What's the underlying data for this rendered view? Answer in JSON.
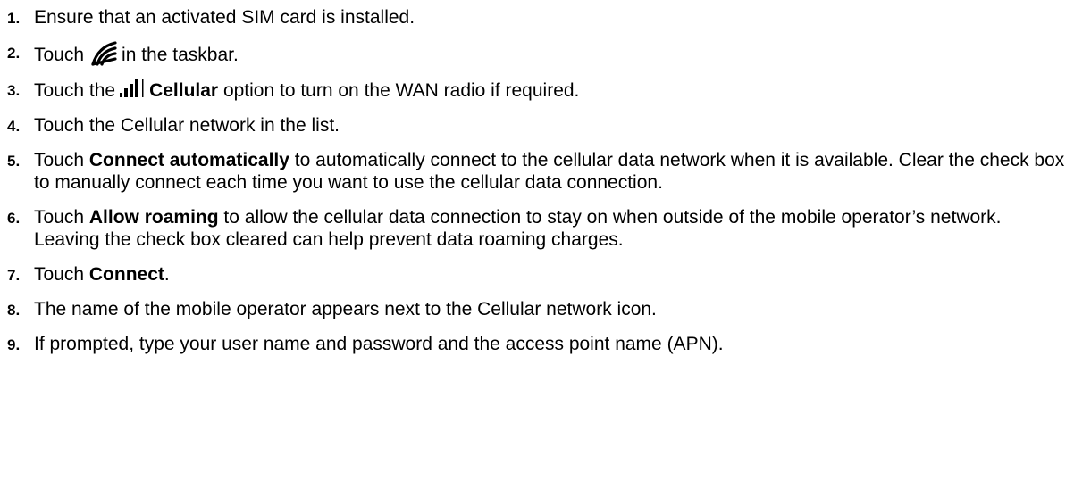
{
  "steps": [
    {
      "number": "1.",
      "parts": [
        "Ensure that an activated SIM card is installed."
      ]
    },
    {
      "number": "2.",
      "before_icon": "Touch",
      "icon": "wireless-fan-icon",
      "after_icon": "in the taskbar."
    },
    {
      "number": "3.",
      "before_icon": "Touch the",
      "icon": "cellular-signal-icon",
      "bold": "Cellular",
      "after_bold": "option to turn on the WAN radio if required."
    },
    {
      "number": "4.",
      "parts": [
        "Touch the Cellular network in the list."
      ]
    },
    {
      "number": "5.",
      "before_bold": "Touch",
      "bold": "Connect automatically",
      "after_bold": "to automatically connect to the cellular data network when it is available. Clear the check box to manually connect each time you want to use the cellular data connection."
    },
    {
      "number": "6.",
      "before_bold": "Touch",
      "bold": "Allow roaming",
      "after_bold": "to allow the cellular data connection to stay on when outside of the mobile operator’s network. Leaving the check box cleared can help prevent data roaming charges."
    },
    {
      "number": "7.",
      "before_bold": "Touch",
      "bold": "Connect",
      "after_bold": "."
    },
    {
      "number": "8.",
      "parts": [
        "The name of the mobile operator appears next to the Cellular network icon."
      ]
    },
    {
      "number": "9.",
      "parts": [
        "If prompted, type your user name and password and the access point name (APN)."
      ]
    }
  ],
  "colors": {
    "text": "#000000",
    "background": "#ffffff"
  }
}
